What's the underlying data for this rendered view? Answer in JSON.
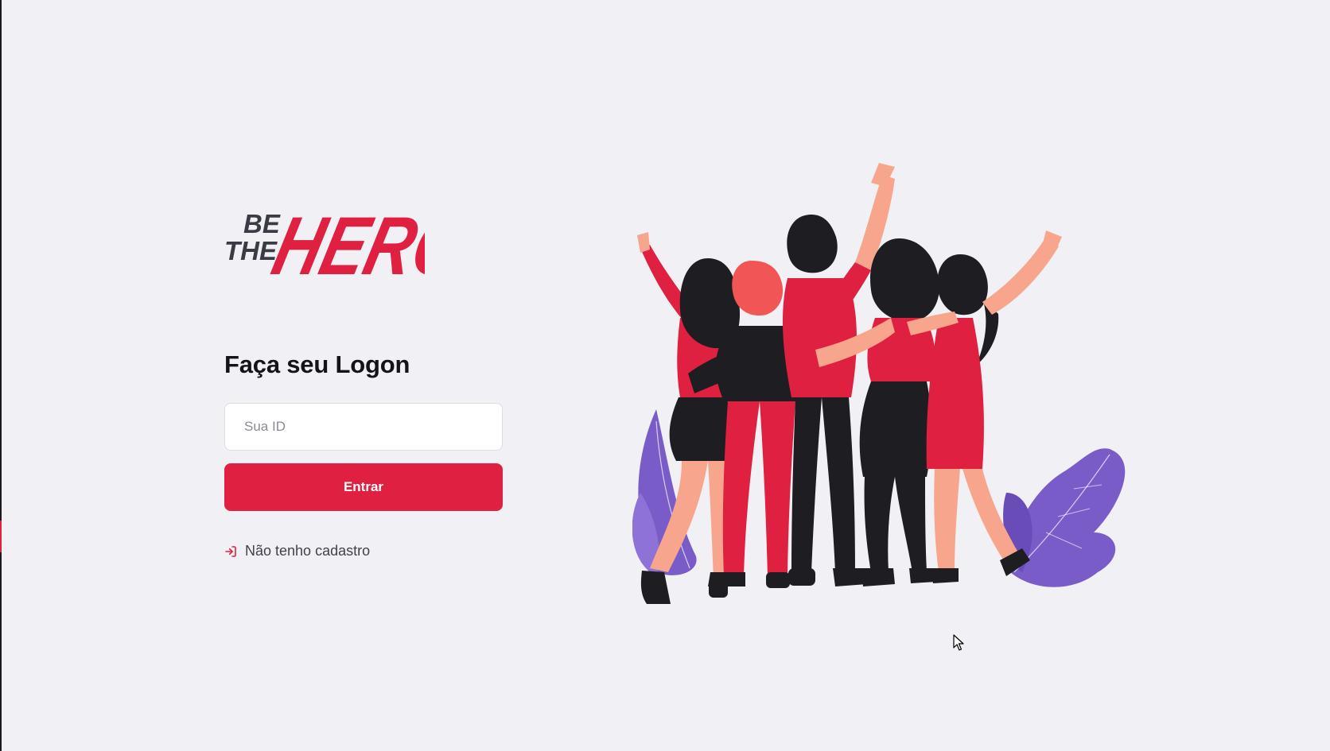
{
  "logo": {
    "line1": "BE",
    "line2": "THE",
    "line3": "HERO"
  },
  "logon": {
    "title": "Faça seu Logon",
    "id_placeholder": "Sua ID",
    "submit_label": "Entrar",
    "register_link": "Não tenho cadastro",
    "register_icon": "log-in-icon"
  },
  "illustration": {
    "name": "heroes-group-illustration"
  },
  "colors": {
    "brand": "#e02041",
    "background": "#f0f0f5",
    "text": "#13131a",
    "muted": "#41414d",
    "purple": "#7a5cc9"
  }
}
